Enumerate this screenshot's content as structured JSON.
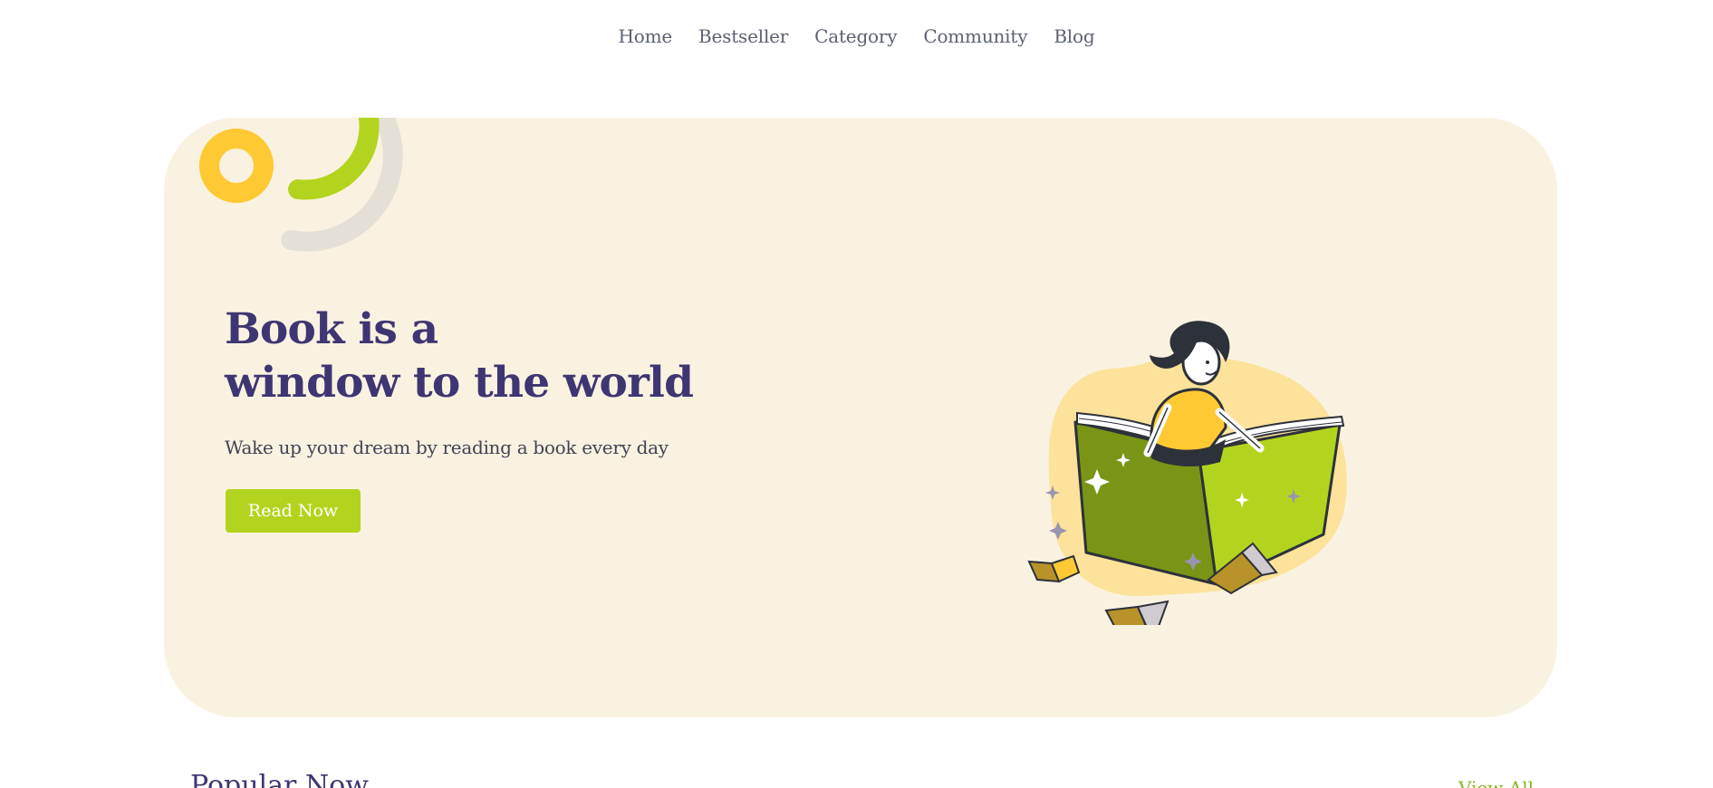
{
  "nav": {
    "items": [
      {
        "label": "Home"
      },
      {
        "label": "Bestseller"
      },
      {
        "label": "Category"
      },
      {
        "label": "Community"
      },
      {
        "label": "Blog"
      }
    ]
  },
  "hero": {
    "headline_line1": "Book is a",
    "headline_line2": "window to the world",
    "subtitle": "Wake up your dream by reading a book every day",
    "cta_label": "Read Now"
  },
  "popular": {
    "title": "Popular Now",
    "view_all_label": "View All"
  },
  "colors": {
    "hero_background": "#faf2e1",
    "headline": "#3e3672",
    "accent_green": "#b3d41e",
    "accent_yellow": "#ffc934",
    "blob": "#fde29b",
    "nav_text": "#5b6173",
    "view_all": "#86b51e"
  }
}
